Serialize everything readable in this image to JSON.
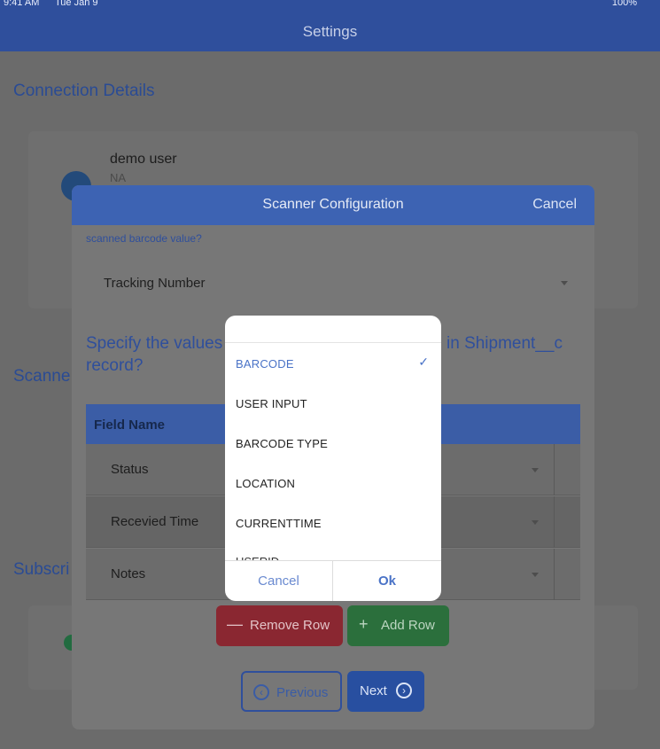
{
  "status_bar": {
    "time": "9:41 AM",
    "date": "Tue Jan 9",
    "battery": "100%"
  },
  "nav": {
    "title": "Settings"
  },
  "background": {
    "connection_details_title": "Connection Details",
    "user_name": "demo user",
    "user_sub": "NA",
    "scanner_title": "Scanne",
    "subscription_title": "Subscri"
  },
  "modal": {
    "title": "Scanner Configuration",
    "cancel_label": "Cancel",
    "question_small": "Specify which field to update with the scanned barcode value?",
    "question_small_visible": "scanned barcode value?",
    "select_value": "Tracking Number",
    "question_big_line1_a": "Specify the values",
    "question_big_line1_b": "in Shipment__c",
    "question_big_line2": "record?",
    "table_header": "Field Name",
    "rows": [
      "Status",
      "Recevied Time",
      "Notes"
    ],
    "remove_row_label": "Remove Row",
    "add_row_label": "Add Row",
    "previous_label": "Previous",
    "next_label": "Next"
  },
  "picker": {
    "options": [
      "BARCODE",
      "USER INPUT",
      "BARCODE TYPE",
      "LOCATION",
      "CURRENTTIME",
      "USERID"
    ],
    "selected": "BARCODE",
    "cancel_label": "Cancel",
    "ok_label": "Ok"
  },
  "colors": {
    "brand": "#2f4f9c",
    "header_blue": "#3d63b3",
    "danger": "#c2383f",
    "success": "#47a357",
    "selected_option": "#4a73c7"
  }
}
